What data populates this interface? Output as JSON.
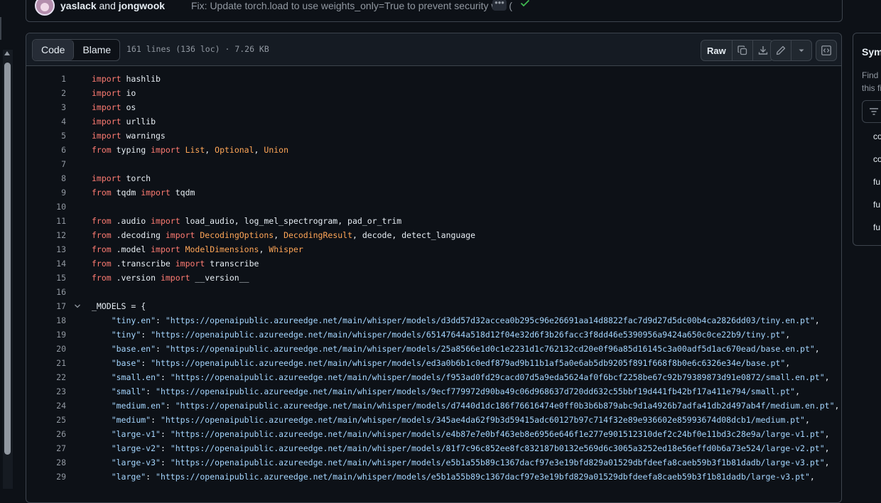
{
  "commit": {
    "author1": "yaslack",
    "conjunction": "and",
    "author2": "jongwook",
    "message": "Fix: Update torch.load to use weights_only=True to prevent security w... (",
    "ellipsis": "•••"
  },
  "toolbar": {
    "tab_code": "Code",
    "tab_blame": "Blame",
    "file_info": "161 lines (136 loc) · 7.26 KB",
    "raw_label": "Raw"
  },
  "symbols": {
    "title": "Sym",
    "desc_line1": "Find c",
    "desc_line2": "this fi",
    "items": [
      "co",
      "co",
      "fu",
      "fu",
      "fu"
    ]
  },
  "code": {
    "lines": [
      {
        "n": "1",
        "html": "<span class=\"kw\">import</span> hashlib"
      },
      {
        "n": "2",
        "html": "<span class=\"kw\">import</span> io"
      },
      {
        "n": "3",
        "html": "<span class=\"kw\">import</span> os"
      },
      {
        "n": "4",
        "html": "<span class=\"kw\">import</span> urllib"
      },
      {
        "n": "5",
        "html": "<span class=\"kw\">import</span> warnings"
      },
      {
        "n": "6",
        "html": "<span class=\"kw\">from</span> typing <span class=\"kw\">import</span> <span class=\"cls\">List</span>, <span class=\"cls\">Optional</span>, <span class=\"cls\">Union</span>"
      },
      {
        "n": "7",
        "html": ""
      },
      {
        "n": "8",
        "html": "<span class=\"kw\">import</span> torch"
      },
      {
        "n": "9",
        "html": "<span class=\"kw\">from</span> tqdm <span class=\"kw\">import</span> tqdm"
      },
      {
        "n": "10",
        "html": ""
      },
      {
        "n": "11",
        "html": "<span class=\"kw\">from</span> .audio <span class=\"kw\">import</span> load_audio, log_mel_spectrogram, pad_or_trim"
      },
      {
        "n": "12",
        "html": "<span class=\"kw\">from</span> .decoding <span class=\"kw\">import</span> <span class=\"cls\">DecodingOptions</span>, <span class=\"cls\">DecodingResult</span>, decode, detect_language"
      },
      {
        "n": "13",
        "html": "<span class=\"kw\">from</span> .model <span class=\"kw\">import</span> <span class=\"cls\">ModelDimensions</span>, <span class=\"cls\">Whisper</span>"
      },
      {
        "n": "14",
        "html": "<span class=\"kw\">from</span> .transcribe <span class=\"kw\">import</span> transcribe"
      },
      {
        "n": "15",
        "html": "<span class=\"kw\">from</span> .version <span class=\"kw\">import</span> __version__"
      },
      {
        "n": "16",
        "html": ""
      },
      {
        "n": "17",
        "html": "_MODELS = {",
        "fold": true
      },
      {
        "n": "18",
        "html": "    <span class=\"str\">\"tiny.en\"</span>: <span class=\"str\">\"https://openaipublic.azureedge.net/main/whisper/models/d3dd57d32accea0b295c96e26691aa14d8822fac7d9d27d5dc00b4ca2826dd03/tiny.en.pt\"</span>,"
      },
      {
        "n": "19",
        "html": "    <span class=\"str\">\"tiny\"</span>: <span class=\"str\">\"https://openaipublic.azureedge.net/main/whisper/models/65147644a518d12f04e32d6f3b26facc3f8dd46e5390956a9424a650c0ce22b9/tiny.pt\"</span>,"
      },
      {
        "n": "20",
        "html": "    <span class=\"str\">\"base.en\"</span>: <span class=\"str\">\"https://openaipublic.azureedge.net/main/whisper/models/25a8566e1d0c1e2231d1c762132cd20e0f96a85d16145c3a00adf5d1ac670ead/base.en.pt\"</span>,"
      },
      {
        "n": "21",
        "html": "    <span class=\"str\">\"base\"</span>: <span class=\"str\">\"https://openaipublic.azureedge.net/main/whisper/models/ed3a0b6b1c0edf879ad9b11b1af5a0e6ab5db9205f891f668f8b0e6c6326e34e/base.pt\"</span>,"
      },
      {
        "n": "22",
        "html": "    <span class=\"str\">\"small.en\"</span>: <span class=\"str\">\"https://openaipublic.azureedge.net/main/whisper/models/f953ad0fd29cacd07d5a9eda5624af0f6bcf2258be67c92b79389873d91e0872/small.en.pt\"</span>,"
      },
      {
        "n": "23",
        "html": "    <span class=\"str\">\"small\"</span>: <span class=\"str\">\"https://openaipublic.azureedge.net/main/whisper/models/9ecf779972d90ba49c06d968637d720dd632c55bbf19d441fb42bf17a411e794/small.pt\"</span>,"
      },
      {
        "n": "24",
        "html": "    <span class=\"str\">\"medium.en\"</span>: <span class=\"str\">\"https://openaipublic.azureedge.net/main/whisper/models/d7440d1dc186f76616474e0ff0b3b6b879abc9d1a4926b7adfa41db2d497ab4f/medium.en.pt\"</span>,"
      },
      {
        "n": "25",
        "html": "    <span class=\"str\">\"medium\"</span>: <span class=\"str\">\"https://openaipublic.azureedge.net/main/whisper/models/345ae4da62f9b3d59415adc60127b97c714f32e89e936602e85993674d08dcb1/medium.pt\"</span>,"
      },
      {
        "n": "26",
        "html": "    <span class=\"str\">\"large-v1\"</span>: <span class=\"str\">\"https://openaipublic.azureedge.net/main/whisper/models/e4b87e7e0bf463eb8e6956e646f1e277e901512310def2c24bf0e11bd3c28e9a/large-v1.pt\"</span>,"
      },
      {
        "n": "27",
        "html": "    <span class=\"str\">\"large-v2\"</span>: <span class=\"str\">\"https://openaipublic.azureedge.net/main/whisper/models/81f7c96c852ee8fc832187b0132e569d6c3065a3252ed18e56effd0b6a73e524/large-v2.pt\"</span>,"
      },
      {
        "n": "28",
        "html": "    <span class=\"str\">\"large-v3\"</span>: <span class=\"str\">\"https://openaipublic.azureedge.net/main/whisper/models/e5b1a55b89c1367dacf97e3e19bfd829a01529dbfdeefa8caeb59b3f1b81dadb/large-v3.pt\"</span>,"
      },
      {
        "n": "29",
        "html": "    <span class=\"str\">\"large\"</span>: <span class=\"str\">\"https://openaipublic.azureedge.net/main/whisper/models/e5b1a55b89c1367dacf97e3e19bfd829a01529dbfdeefa8caeb59b3f1b81dadb/large-v3.pt\"</span>,"
      }
    ]
  }
}
